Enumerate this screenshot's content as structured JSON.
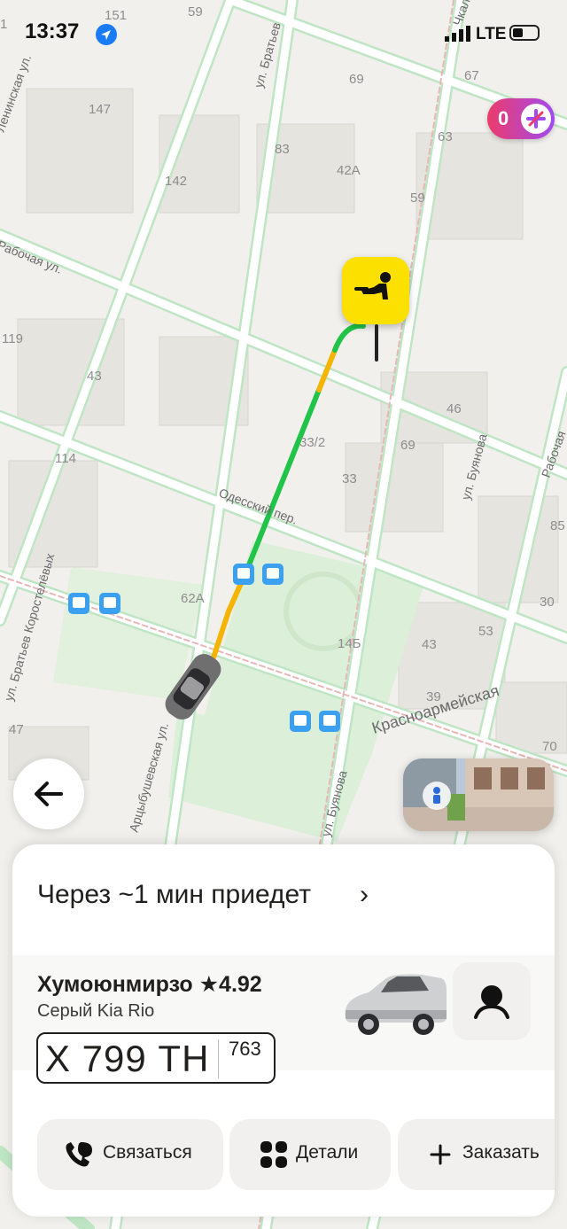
{
  "status_bar": {
    "time": "13:37",
    "network": "LTE"
  },
  "map": {
    "street_labels": [
      "ул. Братьев",
      "Рабочая ул.",
      "Одесский пер.",
      "ул. Буянова",
      "ул. Буянова",
      "Красноармейская",
      "ул. Братьев Коростелёвых",
      "Арцыбушевская ул.",
      "Чкалова",
      "Рабочая",
      "Ленинская ул."
    ],
    "building_numbers": [
      "59",
      "151",
      "69",
      "147",
      "67",
      "63",
      "83",
      "42А",
      "142",
      "59",
      "119",
      "43",
      "46",
      "114",
      "33/2",
      "69",
      "33",
      "85",
      "62А",
      "14Б",
      "30",
      "53",
      "43",
      "39",
      "47",
      "70",
      "1"
    ],
    "transit_icon_name": "bus-stop-icon",
    "route_colors": {
      "green": "#21c349",
      "yellow": "#f4b400"
    }
  },
  "plus": {
    "count": "0"
  },
  "sheet": {
    "eta": "Через ~1 мин приедет",
    "driver_name": "Хумоюнмирзо",
    "rating": "★4.92",
    "car": "Серый Kia Rio",
    "plate_number": "Х 799 ТН",
    "plate_region": "763",
    "actions": [
      {
        "label": "Связаться",
        "icon": "phone-chat-icon"
      },
      {
        "label": "Детали",
        "icon": "grid-icon"
      },
      {
        "label": "Заказать",
        "icon": "plus-icon"
      }
    ]
  },
  "colors": {
    "accent_yellow": "#fce000",
    "plus_gradient_start": "#ec3b6b",
    "plus_gradient_end": "#a24bf0"
  }
}
